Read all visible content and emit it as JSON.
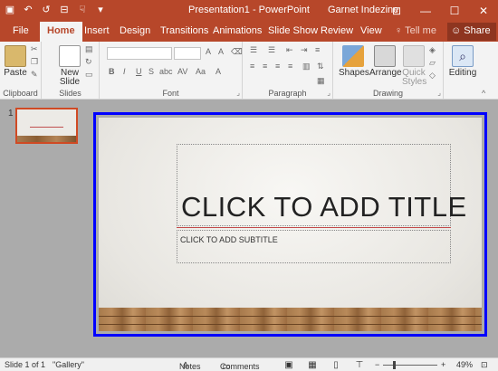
{
  "window": {
    "title": "Presentation1 - PowerPoint",
    "user": "Garnet Indezine",
    "qat": [
      {
        "icon": "save-icon",
        "glyph": "▣"
      },
      {
        "icon": "undo-icon",
        "glyph": "↶"
      },
      {
        "icon": "redo-icon",
        "glyph": "↺"
      },
      {
        "icon": "start-slideshow-icon",
        "glyph": "⊟"
      },
      {
        "icon": "touch-mode-icon",
        "glyph": "☟"
      },
      {
        "icon": "customize-qat-icon",
        "glyph": "▾"
      }
    ],
    "controls": {
      "ribbon_options": "⊡",
      "minimize": "—",
      "maximize": "☐",
      "close": "✕"
    }
  },
  "tabs": {
    "file": "File",
    "items": [
      "Home",
      "Insert",
      "Design",
      "Transitions",
      "Animations",
      "Slide Show",
      "Review",
      "View"
    ],
    "active": "Home",
    "tell_me": "Tell me",
    "share": "Share"
  },
  "ribbon": {
    "groups": [
      "Clipboard",
      "Slides",
      "Font",
      "Paragraph",
      "Drawing"
    ],
    "paste": "Paste",
    "new_slide": "New Slide",
    "shapes": "Shapes",
    "arrange": "Arrange",
    "quick_styles": "Quick Styles",
    "editing": "Editing",
    "font_buttons": [
      "B",
      "I",
      "U",
      "S",
      "abc",
      "AV",
      "Aa",
      "A"
    ]
  },
  "slide_panel": {
    "number": "1"
  },
  "slide": {
    "title_placeholder": "CLICK TO ADD TITLE",
    "subtitle_placeholder": "CLICK TO ADD SUBTITLE"
  },
  "status_bar": {
    "slide_info": "Slide 1 of 1",
    "theme": "\"Gallery\"",
    "notes": "Notes",
    "comments": "Comments",
    "zoom": "49%"
  },
  "colors": {
    "accent": "#b7472a",
    "selection": "#0000ff"
  }
}
